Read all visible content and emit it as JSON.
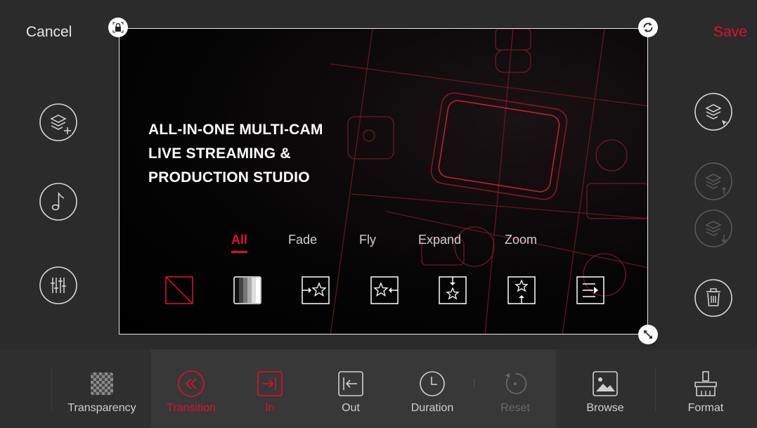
{
  "header": {
    "cancel_label": "Cancel",
    "save_label": "Save"
  },
  "canvas": {
    "headline": [
      "ALL-IN-ONE MULTI-CAM",
      "LIVE STREAMING &",
      "PRODUCTION STUDIO"
    ]
  },
  "transition_tabs": [
    {
      "label": "All",
      "active": true
    },
    {
      "label": "Fade",
      "active": false
    },
    {
      "label": "Fly",
      "active": false
    },
    {
      "label": "Expand",
      "active": false
    },
    {
      "label": "Zoom",
      "active": false
    }
  ],
  "transition_options": [
    "none-icon",
    "fade-gradient-icon",
    "fly-in-right-icon",
    "fly-in-left-icon",
    "fly-in-down-icon",
    "fly-in-up-icon",
    "wipe-right-icon"
  ],
  "left_tools": [
    "add-layer-icon",
    "music-icon",
    "mixer-icon"
  ],
  "right_tools": [
    "select-layer-icon",
    "layer-up-icon",
    "layer-down-icon",
    "delete-icon"
  ],
  "toolbar": {
    "transparency": "Transparency",
    "transition": "Transition",
    "in": "In",
    "out": "Out",
    "duration": "Duration",
    "reset": "Reset",
    "browse": "Browse",
    "format": "Format"
  },
  "colors": {
    "accent": "#e0102e",
    "background": "#2b2b2b",
    "toolbar_highlight": "#383838"
  }
}
